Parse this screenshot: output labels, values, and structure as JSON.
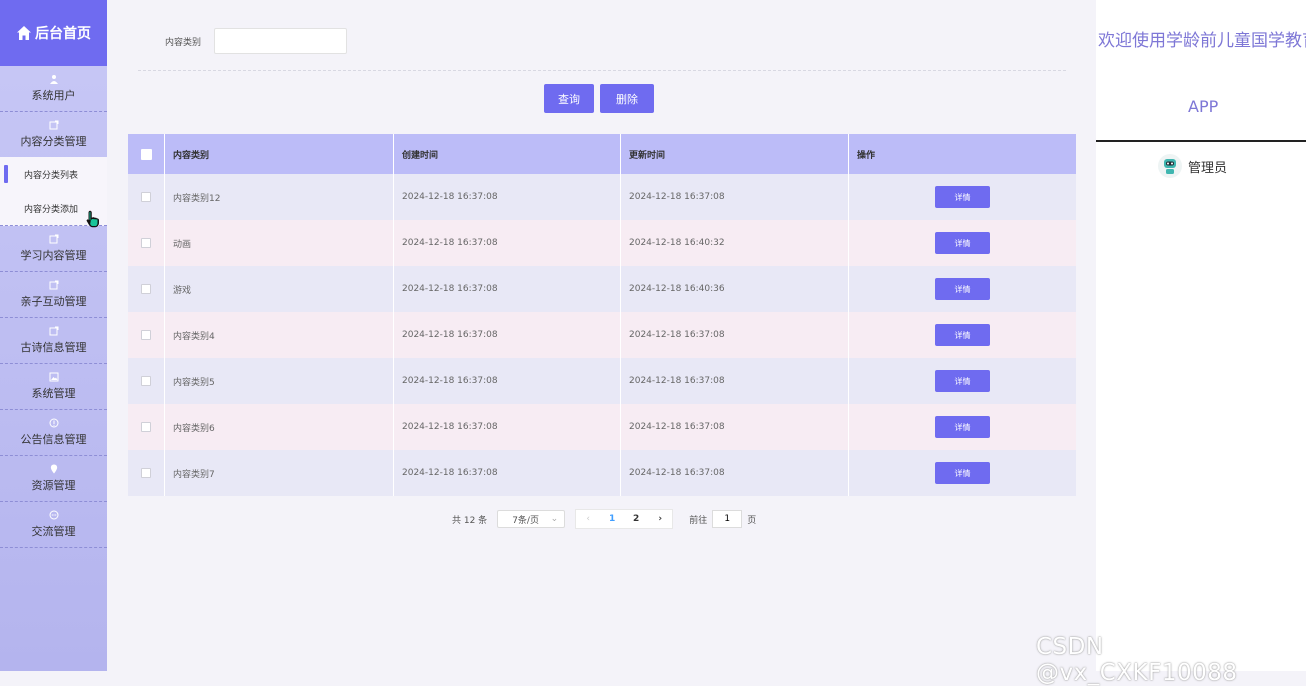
{
  "sidebar": {
    "title": "后台首页",
    "items": [
      {
        "label": "系统用户",
        "icon": "user-icon"
      },
      {
        "label": "内容分类管理",
        "icon": "edit-icon"
      },
      {
        "label": "学习内容管理",
        "icon": "edit-icon"
      },
      {
        "label": "亲子互动管理",
        "icon": "edit-icon"
      },
      {
        "label": "古诗信息管理",
        "icon": "edit-icon"
      },
      {
        "label": "系统管理",
        "icon": "picture-icon"
      },
      {
        "label": "公告信息管理",
        "icon": "info-icon"
      },
      {
        "label": "资源管理",
        "icon": "location-icon"
      },
      {
        "label": "交流管理",
        "icon": "chat-icon"
      }
    ],
    "submenu": [
      {
        "label": "内容分类列表"
      },
      {
        "label": "内容分类添加"
      }
    ]
  },
  "search": {
    "label": "内容类别",
    "value": "",
    "query_label": "查询",
    "delete_label": "删除"
  },
  "table": {
    "columns": [
      "内容类别",
      "创建时间",
      "更新时间",
      "操作"
    ],
    "detail_label": "详情",
    "rows": [
      {
        "type": "内容类别12",
        "created": "2024-12-18 16:37:08",
        "updated": "2024-12-18 16:37:08"
      },
      {
        "type": "动画",
        "created": "2024-12-18 16:37:08",
        "updated": "2024-12-18 16:40:32"
      },
      {
        "type": "游戏",
        "created": "2024-12-18 16:37:08",
        "updated": "2024-12-18 16:40:36"
      },
      {
        "type": "内容类别4",
        "created": "2024-12-18 16:37:08",
        "updated": "2024-12-18 16:37:08"
      },
      {
        "type": "内容类别5",
        "created": "2024-12-18 16:37:08",
        "updated": "2024-12-18 16:37:08"
      },
      {
        "type": "内容类别6",
        "created": "2024-12-18 16:37:08",
        "updated": "2024-12-18 16:37:08"
      },
      {
        "type": "内容类别7",
        "created": "2024-12-18 16:37:08",
        "updated": "2024-12-18 16:37:08"
      }
    ]
  },
  "pagination": {
    "total": "共 12 条",
    "page_size": "7条/页",
    "pages": [
      "1",
      "2"
    ],
    "goto_label": "前往",
    "goto_value": "1",
    "page_unit": "页"
  },
  "header": {
    "welcome": "欢迎使用学龄前儿童国学教育",
    "app": "APP",
    "user": "管理员"
  },
  "watermark": "CSDN @vx_CXKF10088",
  "colors": {
    "accent": "#6f6bf0",
    "table_header": "#bcbcf8",
    "row_odd": "#e8e8f6",
    "row_even": "#f7ecf3",
    "title_text": "#7e77d6"
  }
}
